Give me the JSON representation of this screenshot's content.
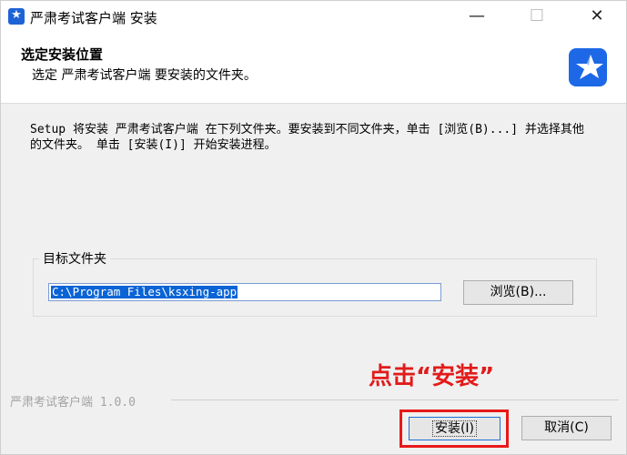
{
  "window": {
    "title": "严肃考试客户端 安装",
    "controls": {
      "minimize": "—",
      "maximize": "☐",
      "close": "✕"
    }
  },
  "header": {
    "title": "选定安装位置",
    "subtitle": "选定 严肃考试客户端 要安装的文件夹。",
    "logo_icon": "app-star-logo"
  },
  "main": {
    "description": "Setup 将安装 严肃考试客户端 在下列文件夹。要安装到不同文件夹，单击 [浏览(B)...] 并选择其他的文件夹。 单击 [安装(I)] 开始安装进程。",
    "folder_group": {
      "label": "目标文件夹",
      "path": "C:\\Program Files\\ksxing-app",
      "browse_label": "浏览(B)..."
    }
  },
  "annotation": "点击“安装”",
  "footer": {
    "brand": "严肃考试客户端 1.0.0",
    "install_label": "安装(I)",
    "cancel_label": "取消(C)"
  },
  "colors": {
    "accent": "#1d68e6",
    "highlight": "#e81919",
    "selection": "#0a64d6"
  }
}
